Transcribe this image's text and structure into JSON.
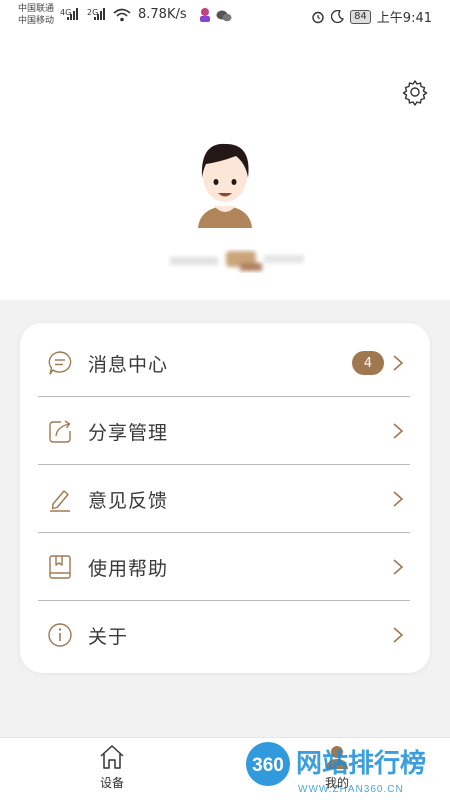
{
  "status_bar": {
    "carrier_1": "中国联通",
    "carrier_2": "中国移动",
    "net_1": "4G",
    "net_2": "2G",
    "speed": "8.78K/s",
    "battery": "84",
    "time": "上午9:41"
  },
  "header": {
    "settings_icon": "gear-icon"
  },
  "menu": {
    "items": [
      {
        "label": "消息中心",
        "icon": "message-icon",
        "badge": "4"
      },
      {
        "label": "分享管理",
        "icon": "share-icon"
      },
      {
        "label": "意见反馈",
        "icon": "edit-icon"
      },
      {
        "label": "使用帮助",
        "icon": "book-icon"
      },
      {
        "label": "关于",
        "icon": "info-icon"
      }
    ]
  },
  "tabbar": {
    "tabs": [
      {
        "label": "设备",
        "icon": "home-icon"
      },
      {
        "label": "我的",
        "icon": "person-icon"
      }
    ]
  },
  "watermark": {
    "brand_number": "360",
    "brand_text": "网站排行榜",
    "url": "WWW.ZHAN360.CN"
  },
  "colors": {
    "accent": "#a07850",
    "background": "#f2f2f2",
    "card": "#ffffff"
  }
}
